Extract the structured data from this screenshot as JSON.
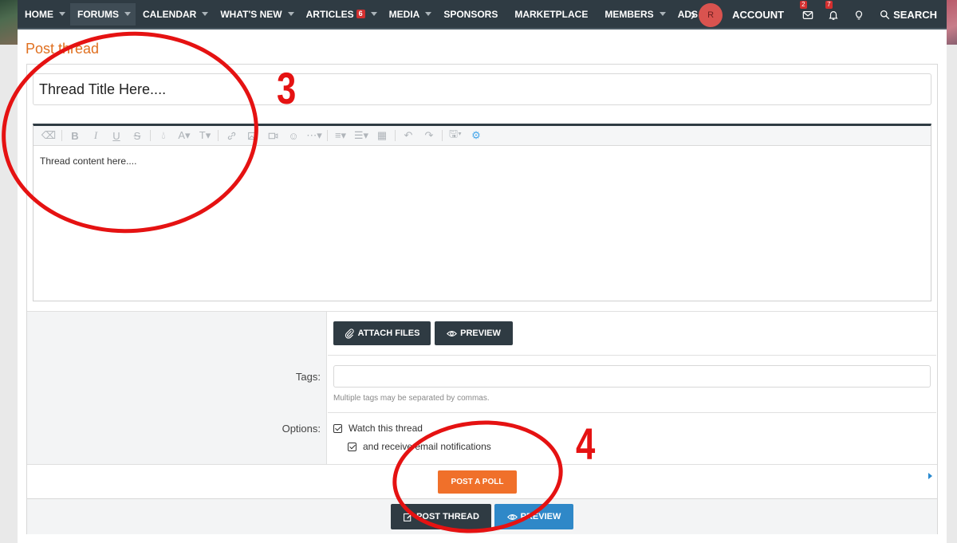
{
  "nav": {
    "items": [
      {
        "label": "HOME",
        "caret": true
      },
      {
        "label": "FORUMS",
        "caret": true,
        "active": true
      },
      {
        "label": "CALENDAR",
        "caret": true
      },
      {
        "label": "WHAT'S NEW",
        "caret": true
      },
      {
        "label": "ARTICLES",
        "caret": true,
        "badge": "6"
      },
      {
        "label": "MEDIA",
        "caret": true
      },
      {
        "label": "SPONSORS",
        "caret": false
      },
      {
        "label": "MARKETPLACE",
        "caret": false
      },
      {
        "label": "MEMBERS",
        "caret": true
      },
      {
        "label": "ADS MAN",
        "caret": false
      }
    ],
    "avatar_initial": "R",
    "account_label": "ACCOUNT",
    "inbox_badge": "2",
    "alerts_badge": "7",
    "search_label": "SEARCH"
  },
  "page": {
    "title": "Post thread"
  },
  "form": {
    "title_value": "Thread Title Here....",
    "content_value": "Thread content here....",
    "attach_label": "ATTACH FILES",
    "preview_label": "PREVIEW",
    "tags_label": "Tags:",
    "tags_hint": "Multiple tags may be separated by commas.",
    "options_label": "Options:",
    "watch_label": "Watch this thread",
    "email_label": "and receive email notifications",
    "poll_label": "POST A POLL",
    "post_label": "POST THREAD",
    "preview2_label": "PREVIEW"
  },
  "annotations": {
    "step_a": "3",
    "step_b": "4",
    "color": "#e51212"
  },
  "colors": {
    "nav_bg": "#2f3b43",
    "accent_orange": "#f0702a",
    "title_orange": "#e07020",
    "button_blue": "#2f88c8",
    "badge_red": "#d32f2f"
  }
}
